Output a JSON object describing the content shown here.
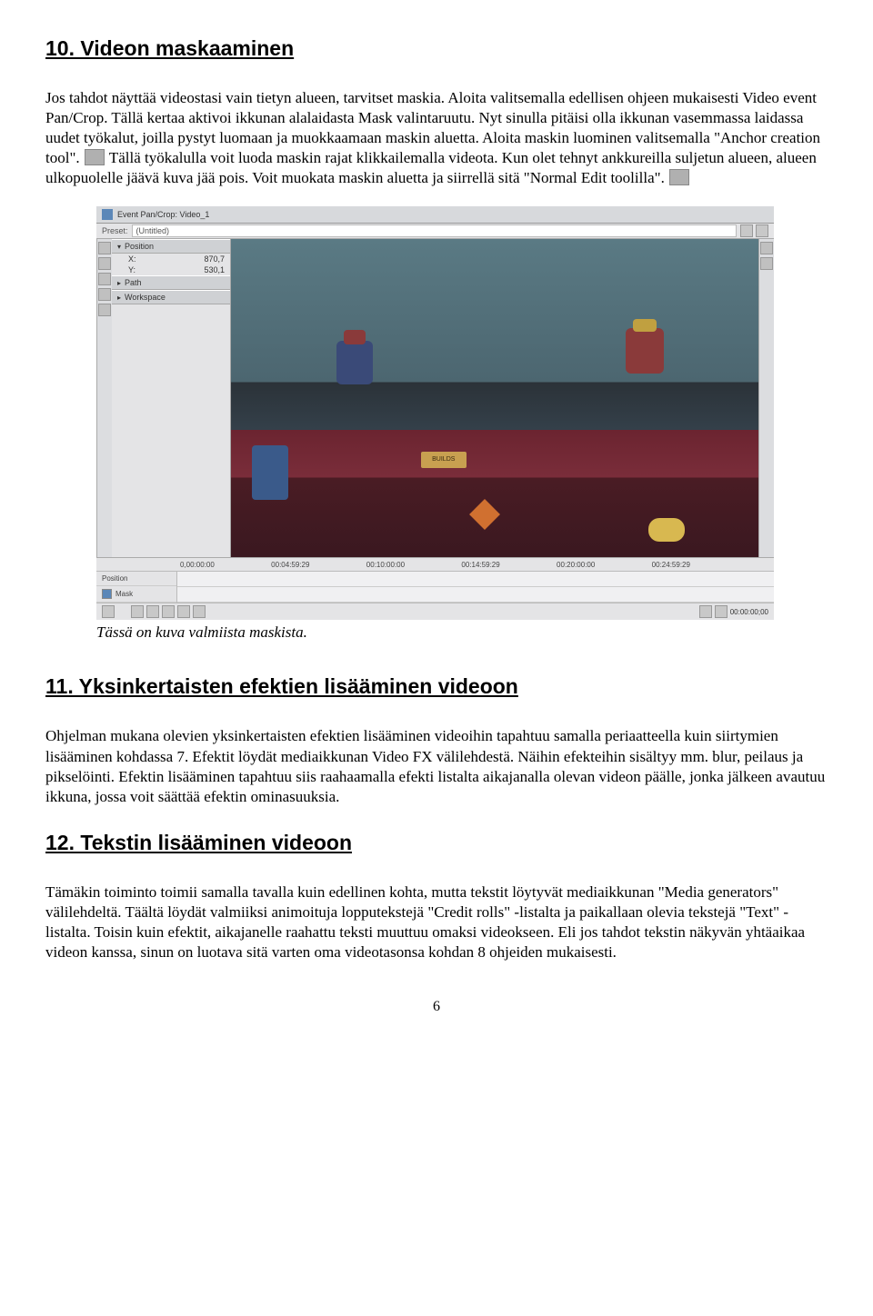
{
  "section10": {
    "title": "10. Videon maskaaminen",
    "para": "Jos tahdot näyttää videostasi vain tietyn alueen, tarvitset maskia. Aloita valitsemalla edellisen ohjeen mukaisesti Video event Pan/Crop. Tällä kertaa aktivoi ikkunan alalaidasta Mask valintaruutu. Nyt sinulla pitäisi olla ikkunan vasemmassa laidassa uudet työkalut, joilla pystyt luomaan ja muokkaamaan maskin aluetta. Aloita maskin luominen valitsemalla \"Anchor creation tool\". ",
    "para_after_icon": " Tällä työkalulla voit luoda maskin rajat klikkailemalla videota. Kun olet tehnyt ankkureilla suljetun alueen, alueen ulkopuolelle jäävä kuva jää pois. Voit muokata maskin aluetta ja siirrellä sitä \"Normal Edit toolilla\". "
  },
  "screenshot": {
    "title": "Event Pan/Crop: Video_1",
    "preset_label": "Preset:",
    "preset_value": "(Untitled)",
    "panels": {
      "position": "Position",
      "x_label": "X:",
      "x_value": "870,7",
      "y_label": "Y:",
      "y_value": "530,1",
      "path": "Path",
      "workspace": "Workspace"
    },
    "canvas_sign": "BUILDS",
    "timeline": {
      "t0": "0,00:00:00",
      "t1": "00:04:59:29",
      "t2": "00:10:00:00",
      "t3": "00:14:59:29",
      "t4": "00:20:00:00",
      "t5": "00:24:59:29",
      "position": "Position",
      "mask": "Mask",
      "timecode": "00:00:00;00"
    }
  },
  "caption": "Tässä on kuva valmiista maskista.",
  "section11": {
    "title": "11. Yksinkertaisten efektien lisääminen videoon",
    "para": "Ohjelman mukana olevien yksinkertaisten efektien lisääminen videoihin tapahtuu samalla periaatteella kuin siirtymien lisääminen kohdassa 7. Efektit löydät mediaikkunan Video FX välilehdestä. Näihin efekteihin sisältyy mm. blur, peilaus ja pikselöinti. Efektin lisääminen tapahtuu siis raahaamalla efekti listalta aikajanalla olevan videon päälle, jonka jälkeen avautuu ikkuna, jossa voit säättää efektin ominasuuksia."
  },
  "section12": {
    "title": "12. Tekstin lisääminen videoon",
    "para": "Tämäkin toiminto toimii samalla tavalla kuin edellinen kohta, mutta tekstit löytyvät mediaikkunan \"Media generators\" välilehdeltä. Täältä löydät valmiiksi animoituja lopputekstejä \"Credit rolls\" -listalta ja paikallaan olevia tekstejä \"Text\" -listalta. Toisin kuin efektit, aikajanelle raahattu teksti muuttuu omaksi videokseen. Eli jos tahdot tekstin näkyvän yhtäaikaa videon kanssa, sinun on luotava sitä varten oma videotasonsa kohdan 8 ohjeiden mukaisesti."
  },
  "page_number": "6"
}
